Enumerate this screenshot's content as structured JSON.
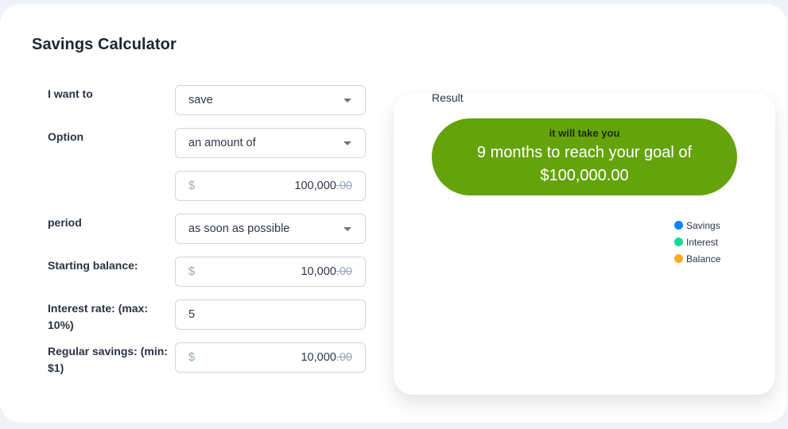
{
  "page": {
    "title": "Savings Calculator"
  },
  "form": {
    "goal": {
      "label": "I want to",
      "value": "save"
    },
    "option": {
      "label": "Option",
      "value": "an amount of"
    },
    "target_amount": {
      "currency": "$",
      "integer": "100,000",
      "decimals": ".00"
    },
    "period": {
      "label": "period",
      "value": "as soon as possible"
    },
    "starting_balance": {
      "label": "Starting balance:",
      "currency": "$",
      "integer": "10,000",
      "decimals": ".00"
    },
    "interest_rate": {
      "label": "Interest rate: (max: 10%)",
      "value": "5"
    },
    "regular_savings": {
      "label": "Regular savings: (min: $1)",
      "currency": "$",
      "integer": "10,000",
      "decimals": ".00"
    }
  },
  "result": {
    "label": "Result",
    "subtitle": "it will take you",
    "headline": "9 months to reach your goal of",
    "goal_amount": "$100,000.00",
    "accent_color": "#65a30d"
  },
  "legend": [
    {
      "label": "Savings",
      "color": "#0a84ff"
    },
    {
      "label": "Interest",
      "color": "#14d99a"
    },
    {
      "label": "Balance",
      "color": "#fbab1d"
    }
  ]
}
